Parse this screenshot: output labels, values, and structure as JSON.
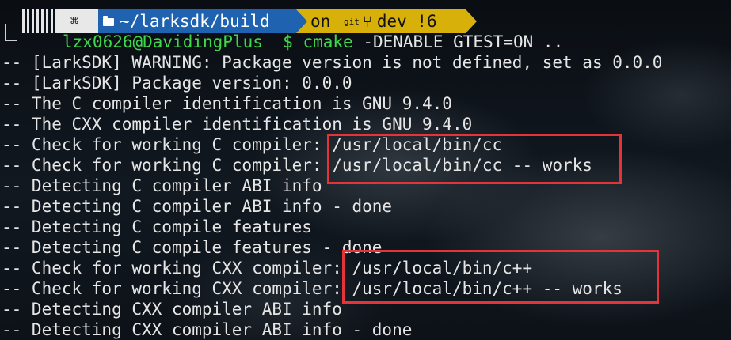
{
  "prompt": {
    "os_glyph": "⌘",
    "directory": "~/larksdk/build",
    "git_on": "on",
    "git_label": "git",
    "branch_icon": "⑂",
    "branch": "dev !6"
  },
  "command": {
    "user_host": "lzx0626@DavidingPlus",
    "dollar": "$",
    "program": "cmake",
    "args": " -DENABLE_GTEST=ON .."
  },
  "output_lines": [
    "-- [LarkSDK] WARNING: Package version is not defined, set as 0.0.0",
    "-- [LarkSDK] Package version: 0.0.0",
    "-- The C compiler identification is GNU 9.4.0",
    "-- The CXX compiler identification is GNU 9.4.0",
    "-- Check for working C compiler: /usr/local/bin/cc",
    "-- Check for working C compiler: /usr/local/bin/cc -- works",
    "-- Detecting C compiler ABI info",
    "-- Detecting C compiler ABI info - done",
    "-- Detecting C compile features",
    "-- Detecting C compile features - done",
    "-- Check for working CXX compiler: /usr/local/bin/c++",
    "-- Check for working CXX compiler: /usr/local/bin/c++ -- works",
    "-- Detecting CXX compiler ABI info",
    "-- Detecting CXX compiler ABI info - done"
  ],
  "colors": {
    "highlight": "#e5333a",
    "prompt_green": "#3fd84a",
    "dir_blue": "#1e62b0",
    "git_yellow": "#d7b10a",
    "text": "#e6e6e6"
  }
}
